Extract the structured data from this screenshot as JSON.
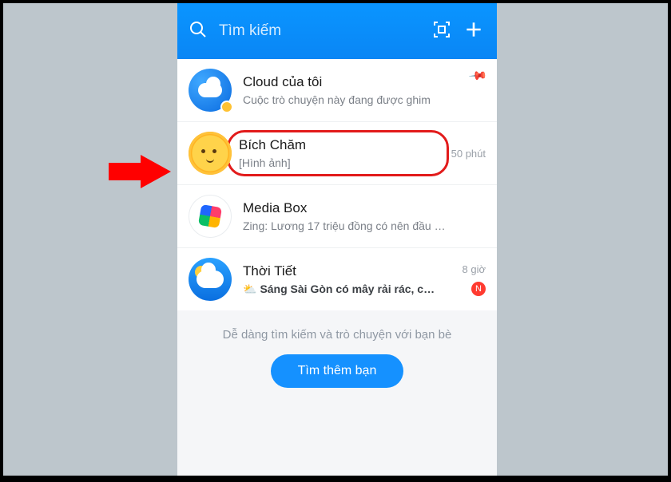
{
  "header": {
    "search_placeholder": "Tìm kiếm",
    "qr_icon": "qr-scan-icon",
    "plus_icon": "plus-icon"
  },
  "chats": [
    {
      "name": "Cloud của tôi",
      "sub": "Cuộc trò chuyện này đang được ghim",
      "meta": "",
      "pinned": true
    },
    {
      "name": "Bích Chăm",
      "sub": "[Hình ảnh]",
      "meta": "50 phút",
      "highlighted": true
    },
    {
      "name": "Media Box",
      "sub": "Zing: Lương 17 triệu đồng có nên đầu tư...",
      "meta": ""
    },
    {
      "name": "Thời Tiết",
      "sub": "Sáng Sài Gòn có mây rải rác, chiều...",
      "meta": "8 giờ",
      "badge": "N",
      "emoji": "⛅"
    }
  ],
  "footer": {
    "hint": "Dễ dàng tìm kiếm và trò chuyện với bạn bè",
    "button": "Tìm thêm bạn"
  }
}
